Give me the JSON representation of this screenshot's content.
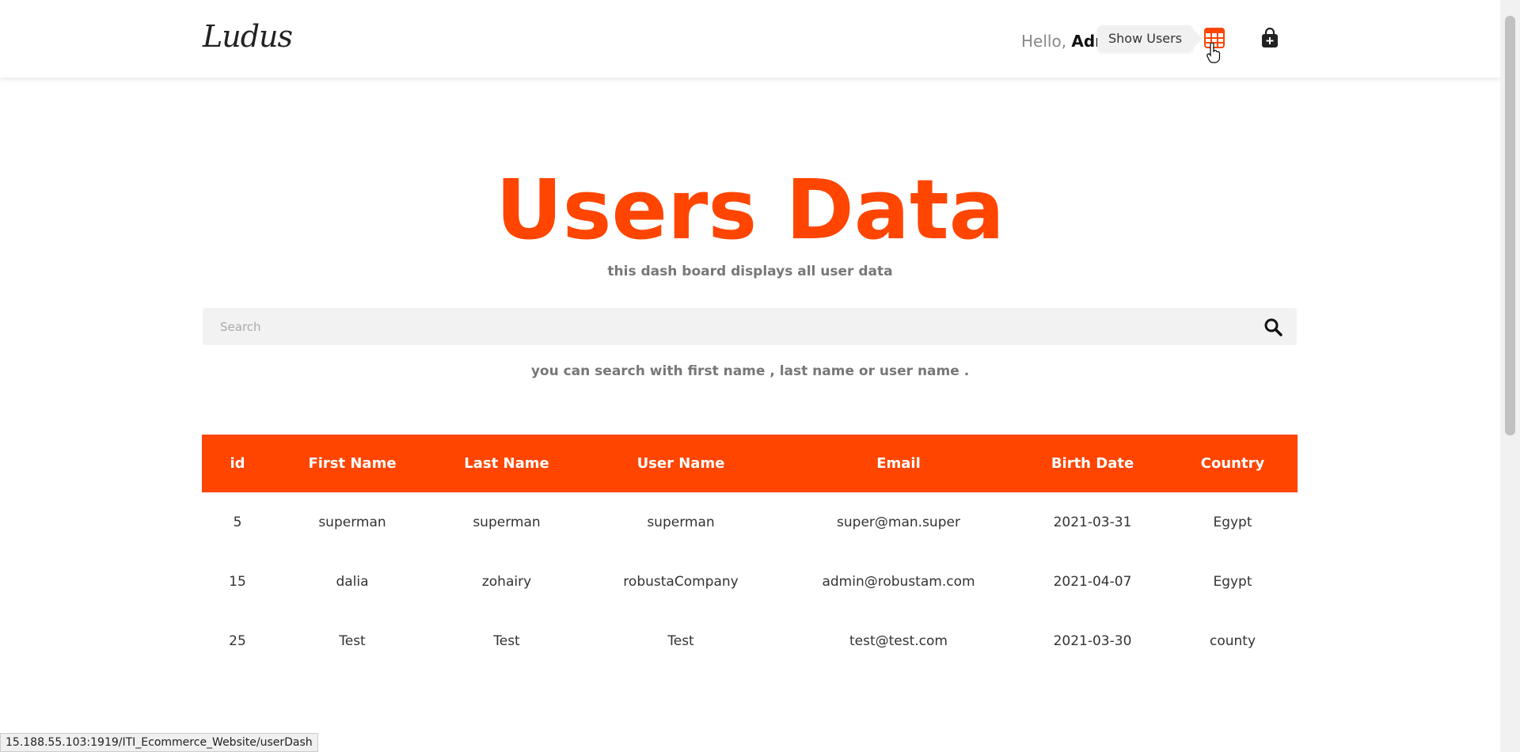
{
  "header": {
    "logo": "Ludus",
    "greeting_prefix": "Hello,",
    "greeting_name": "Adm",
    "tooltip": "Show Users",
    "icons": [
      "table-icon",
      "shopping-bag-plus-icon"
    ]
  },
  "main": {
    "title": "Users Data",
    "subtitle": "this dash board displays all user data",
    "search": {
      "placeholder": "Search",
      "value": ""
    },
    "hint": "you can search with first name , last name or user name ."
  },
  "table": {
    "headers": [
      "id",
      "First Name",
      "Last Name",
      "User Name",
      "Email",
      "Birth Date",
      "Country"
    ],
    "rows": [
      [
        "5",
        "superman",
        "superman",
        "superman",
        "super@man.super",
        "2021-03-31",
        "Egypt"
      ],
      [
        "15",
        "dalia",
        "zohairy",
        "robustaCompany",
        "admin@robustam.com",
        "2021-04-07",
        "Egypt"
      ],
      [
        "25",
        "Test",
        "Test",
        "Test",
        "test@test.com",
        "2021-03-30",
        "county"
      ]
    ]
  },
  "status_bar": {
    "url": "15.188.55.103:1919/ITI_Ecommerce_Website/userDash"
  },
  "colors": {
    "accent": "#ff4500",
    "text_muted": "#777777",
    "search_bg": "#f2f2f2"
  }
}
